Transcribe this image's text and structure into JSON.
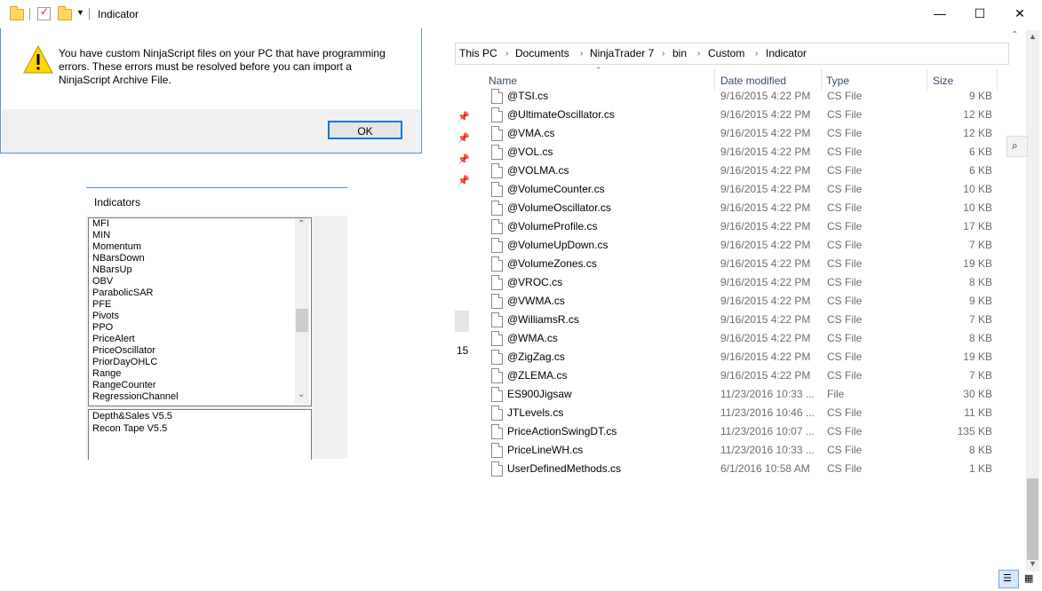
{
  "window": {
    "title": "Indicator",
    "min_glyph": "—",
    "max_glyph": "☐",
    "close_glyph": "✕"
  },
  "dialog": {
    "message": "You have custom NinjaScript files on your PC that have programming errors. These errors must be resolved before you can import a NinjaScript Archive File.",
    "ok_label": "OK"
  },
  "explorer": {
    "breadcrumb": [
      "This PC",
      "Documents",
      "NinjaTrader 7",
      "bin",
      "Custom",
      "Indicator"
    ],
    "columns": {
      "name": "Name",
      "date": "Date modified",
      "type": "Type",
      "size": "Size"
    },
    "side_number": "15",
    "files": [
      {
        "name": "@TSI.cs",
        "date": "9/16/2015 4:22 PM",
        "type": "CS File",
        "size": "9 KB"
      },
      {
        "name": "@UltimateOscillator.cs",
        "date": "9/16/2015 4:22 PM",
        "type": "CS File",
        "size": "12 KB"
      },
      {
        "name": "@VMA.cs",
        "date": "9/16/2015 4:22 PM",
        "type": "CS File",
        "size": "12 KB"
      },
      {
        "name": "@VOL.cs",
        "date": "9/16/2015 4:22 PM",
        "type": "CS File",
        "size": "6 KB"
      },
      {
        "name": "@VOLMA.cs",
        "date": "9/16/2015 4:22 PM",
        "type": "CS File",
        "size": "6 KB"
      },
      {
        "name": "@VolumeCounter.cs",
        "date": "9/16/2015 4:22 PM",
        "type": "CS File",
        "size": "10 KB"
      },
      {
        "name": "@VolumeOscillator.cs",
        "date": "9/16/2015 4:22 PM",
        "type": "CS File",
        "size": "10 KB"
      },
      {
        "name": "@VolumeProfile.cs",
        "date": "9/16/2015 4:22 PM",
        "type": "CS File",
        "size": "17 KB"
      },
      {
        "name": "@VolumeUpDown.cs",
        "date": "9/16/2015 4:22 PM",
        "type": "CS File",
        "size": "7 KB"
      },
      {
        "name": "@VolumeZones.cs",
        "date": "9/16/2015 4:22 PM",
        "type": "CS File",
        "size": "19 KB"
      },
      {
        "name": "@VROC.cs",
        "date": "9/16/2015 4:22 PM",
        "type": "CS File",
        "size": "8 KB"
      },
      {
        "name": "@VWMA.cs",
        "date": "9/16/2015 4:22 PM",
        "type": "CS File",
        "size": "9 KB"
      },
      {
        "name": "@WilliamsR.cs",
        "date": "9/16/2015 4:22 PM",
        "type": "CS File",
        "size": "7 KB"
      },
      {
        "name": "@WMA.cs",
        "date": "9/16/2015 4:22 PM",
        "type": "CS File",
        "size": "8 KB"
      },
      {
        "name": "@ZigZag.cs",
        "date": "9/16/2015 4:22 PM",
        "type": "CS File",
        "size": "19 KB"
      },
      {
        "name": "@ZLEMA.cs",
        "date": "9/16/2015 4:22 PM",
        "type": "CS File",
        "size": "7 KB"
      },
      {
        "name": "ES900Jigsaw",
        "date": "11/23/2016 10:33 ...",
        "type": "File",
        "size": "30 KB"
      },
      {
        "name": "JTLevels.cs",
        "date": "11/23/2016 10:46 ...",
        "type": "CS File",
        "size": "11 KB"
      },
      {
        "name": "PriceActionSwingDT.cs",
        "date": "11/23/2016 10:07 ...",
        "type": "CS File",
        "size": "135 KB"
      },
      {
        "name": "PriceLineWH.cs",
        "date": "11/23/2016 10:33 ...",
        "type": "CS File",
        "size": "8 KB"
      },
      {
        "name": "UserDefinedMethods.cs",
        "date": "6/1/2016 10:58 AM",
        "type": "CS File",
        "size": "1 KB"
      }
    ]
  },
  "indicators": {
    "title": "Indicators",
    "items": [
      "MFI",
      "MIN",
      "Momentum",
      "NBarsDown",
      "NBarsUp",
      "OBV",
      "ParabolicSAR",
      "PFE",
      "Pivots",
      "PPO",
      "PriceAlert",
      "PriceOscillator",
      "PriorDayOHLC",
      "Range",
      "RangeCounter",
      "RegressionChannel"
    ],
    "custom_items": [
      "Depth&Sales V5.5",
      "Recon Tape V5.5"
    ]
  }
}
